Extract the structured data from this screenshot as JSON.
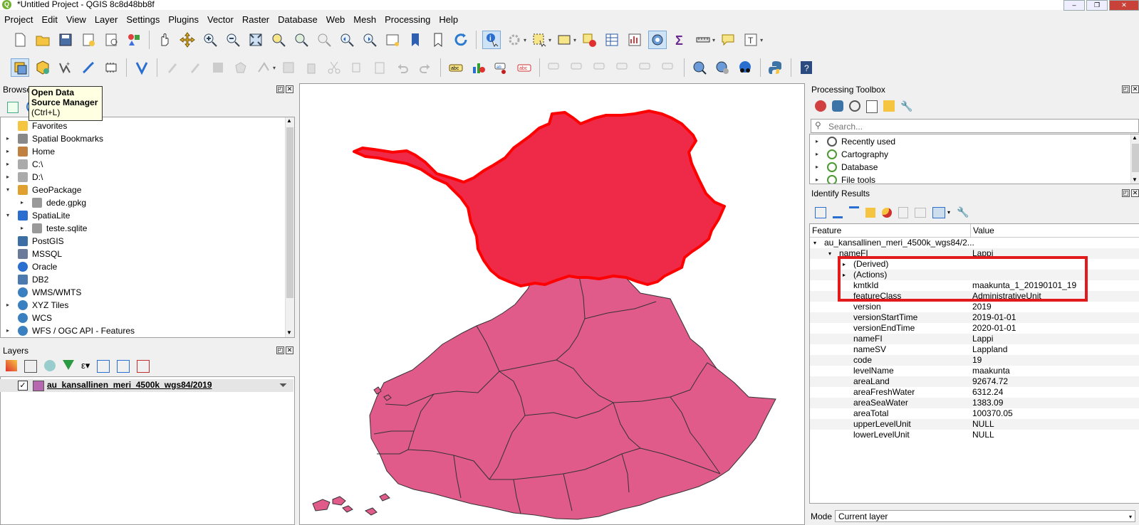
{
  "window": {
    "title": "*Untitled Project - QGIS 8c8d48bb8f",
    "app_icon_letter": "Q"
  },
  "menu": [
    "Project",
    "Edit",
    "View",
    "Layer",
    "Settings",
    "Plugins",
    "Vector",
    "Raster",
    "Database",
    "Web",
    "Mesh",
    "Processing",
    "Help"
  ],
  "tooltip": {
    "line1": "Open Data",
    "line2": "Source Manager",
    "line3": "(Ctrl+L)"
  },
  "browser": {
    "title": "Browser",
    "items": [
      {
        "label": "Favorites",
        "icon": "star-icon",
        "indent": 0,
        "arrow": ""
      },
      {
        "label": "Spatial Bookmarks",
        "icon": "bookmark-icon",
        "indent": 0,
        "arrow": "▸"
      },
      {
        "label": "Home",
        "icon": "home-icon",
        "indent": 0,
        "arrow": "▸"
      },
      {
        "label": "C:\\",
        "icon": "drive-icon",
        "indent": 0,
        "arrow": "▸"
      },
      {
        "label": "D:\\",
        "icon": "drive-icon",
        "indent": 0,
        "arrow": "▸"
      },
      {
        "label": "GeoPackage",
        "icon": "geopackage-icon",
        "indent": 0,
        "arrow": "▾"
      },
      {
        "label": "dede.gpkg",
        "icon": "database-icon",
        "indent": 1,
        "arrow": "▸"
      },
      {
        "label": "SpatiaLite",
        "icon": "spatialite-icon",
        "indent": 0,
        "arrow": "▾"
      },
      {
        "label": "teste.sqlite",
        "icon": "database-icon",
        "indent": 1,
        "arrow": "▸"
      },
      {
        "label": "PostGIS",
        "icon": "postgis-icon",
        "indent": 0,
        "arrow": ""
      },
      {
        "label": "MSSQL",
        "icon": "mssql-icon",
        "indent": 0,
        "arrow": ""
      },
      {
        "label": "Oracle",
        "icon": "oracle-icon",
        "indent": 0,
        "arrow": ""
      },
      {
        "label": "DB2",
        "icon": "db2-icon",
        "indent": 0,
        "arrow": ""
      },
      {
        "label": "WMS/WMTS",
        "icon": "globe-icon",
        "indent": 0,
        "arrow": ""
      },
      {
        "label": "XYZ Tiles",
        "icon": "globe-icon",
        "indent": 0,
        "arrow": "▸"
      },
      {
        "label": "WCS",
        "icon": "globe-icon",
        "indent": 0,
        "arrow": ""
      },
      {
        "label": "WFS / OGC API - Features",
        "icon": "globe-icon",
        "indent": 0,
        "arrow": "▸"
      }
    ]
  },
  "layers": {
    "title": "Layers",
    "layer_name": "au_kansallinen_meri_4500k_wgs84/2019",
    "layer_color": "#b766b0",
    "checked": true
  },
  "processing": {
    "title": "Processing Toolbox",
    "search_placeholder": "Search...",
    "items": [
      "Recently used",
      "Cartography",
      "Database",
      "File tools"
    ]
  },
  "identify": {
    "title": "Identify Results",
    "col_feature": "Feature",
    "col_value": "Value",
    "root": "au_kansallinen_meri_4500k_wgs84/2...",
    "parent_field": "nameFI",
    "parent_value": "Lappi",
    "rows": [
      {
        "k": "(Derived)",
        "v": "",
        "arrow": true
      },
      {
        "k": "(Actions)",
        "v": "",
        "arrow": true
      },
      {
        "k": "kmtkId",
        "v": "maakunta_1_20190101_19"
      },
      {
        "k": "featureClass",
        "v": "AdministrativeUnit"
      },
      {
        "k": "version",
        "v": "2019"
      },
      {
        "k": "versionStartTime",
        "v": "2019-01-01"
      },
      {
        "k": "versionEndTime",
        "v": "2020-01-01"
      },
      {
        "k": "nameFI",
        "v": "Lappi"
      },
      {
        "k": "nameSV",
        "v": "Lappland"
      },
      {
        "k": "code",
        "v": "19"
      },
      {
        "k": "levelName",
        "v": "maakunta"
      },
      {
        "k": "areaLand",
        "v": "92674.72"
      },
      {
        "k": "areaFreshWater",
        "v": "6312.24"
      },
      {
        "k": "areaSeaWater",
        "v": "1383.09"
      },
      {
        "k": "areaTotal",
        "v": "100370.05"
      },
      {
        "k": "upperLevelUnit",
        "v": "NULL"
      },
      {
        "k": "lowerLevelUnit",
        "v": "NULL"
      }
    ],
    "mode_label": "Mode",
    "mode_value": "Current layer"
  },
  "colors": {
    "region_fill": "#e05a8a",
    "selected_fill": "#ef2a48",
    "highlight": "#e31a1c",
    "layer_swatch": "#b766b0"
  }
}
